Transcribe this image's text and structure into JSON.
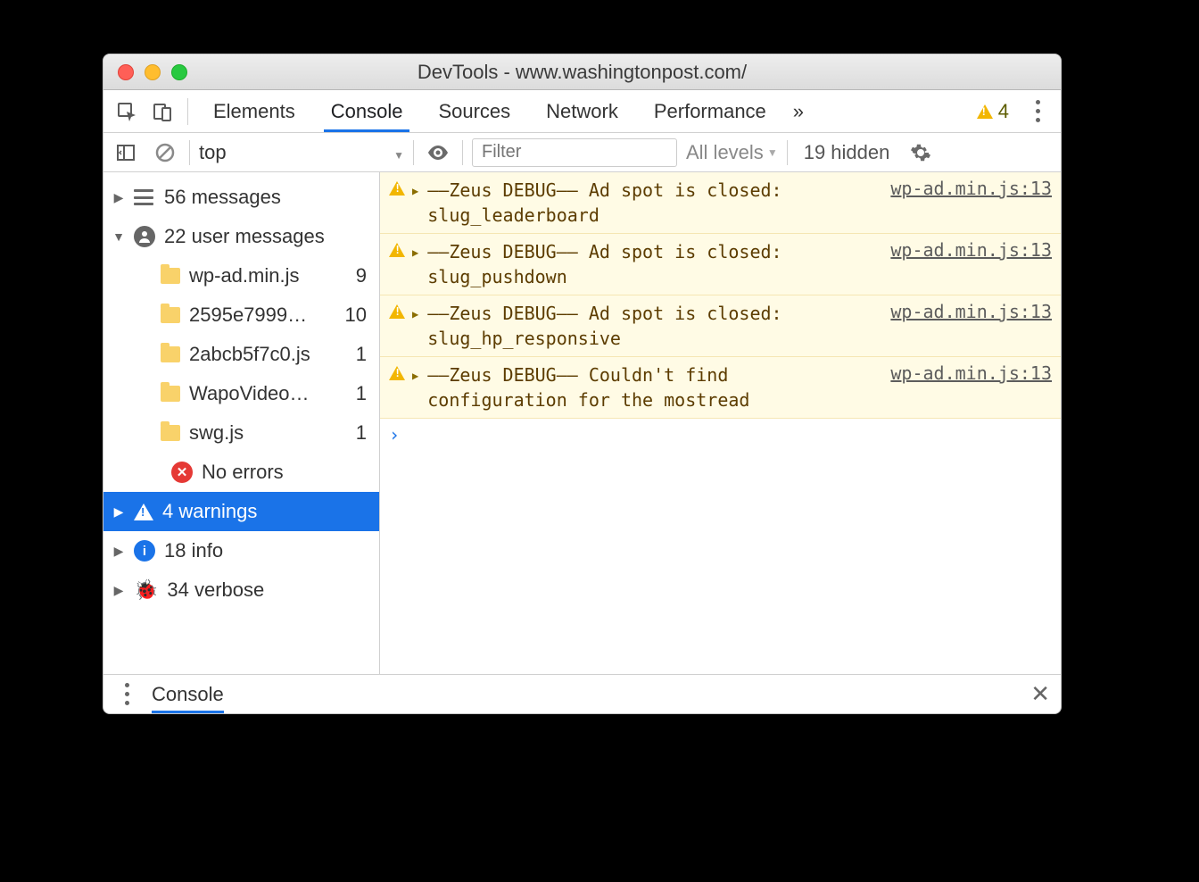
{
  "window": {
    "title": "DevTools - www.washingtonpost.com/"
  },
  "tabs": {
    "items": [
      "Elements",
      "Console",
      "Sources",
      "Network",
      "Performance"
    ],
    "active": 1,
    "overflow": "»",
    "warning_count": "4"
  },
  "toolbar": {
    "context": "top",
    "filter_placeholder": "Filter",
    "levels": "All levels",
    "hidden": "19 hidden"
  },
  "sidebar": {
    "messages": {
      "label": "56 messages"
    },
    "user": {
      "label": "22 user messages"
    },
    "files": [
      {
        "name": "wp-ad.min.js",
        "count": "9"
      },
      {
        "name": "2595e7999…",
        "count": "10"
      },
      {
        "name": "2abcb5f7c0.js",
        "count": "1"
      },
      {
        "name": "WapoVideo…",
        "count": "1"
      },
      {
        "name": "swg.js",
        "count": "1"
      }
    ],
    "errors": {
      "label": "No errors"
    },
    "warnings": {
      "label": "4 warnings"
    },
    "info": {
      "label": "18 info"
    },
    "verbose": {
      "label": "34 verbose"
    }
  },
  "console": {
    "messages": [
      {
        "text": "––Zeus DEBUG–– Ad spot is closed: slug_leaderboard",
        "source": "wp-ad.min.js:13"
      },
      {
        "text": "––Zeus DEBUG–– Ad spot is closed: slug_pushdown",
        "source": "wp-ad.min.js:13"
      },
      {
        "text": "––Zeus DEBUG–– Ad spot is closed: slug_hp_responsive",
        "source": "wp-ad.min.js:13"
      },
      {
        "text": "––Zeus DEBUG–– Couldn't find configuration for the mostread",
        "source": "wp-ad.min.js:13"
      }
    ],
    "prompt": "›"
  },
  "drawer": {
    "label": "Console"
  }
}
